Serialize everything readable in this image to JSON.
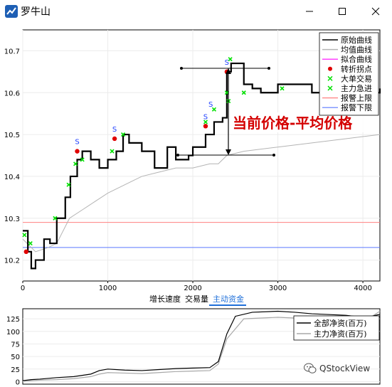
{
  "window": {
    "title": "罗牛山"
  },
  "main_chart": {
    "y_ticks": [
      "10.7",
      "10.6",
      "10.5",
      "10.4",
      "10.3",
      "10.2"
    ],
    "x_ticks": [
      "0",
      "1000",
      "2000",
      "3000",
      "4000"
    ],
    "legend": [
      "原始曲线",
      "均值曲线",
      "拟合曲线",
      "转折拐点",
      "大单交易",
      "主力急进",
      "报警上限",
      "报警下限"
    ],
    "annotation": "当前价格-平均价格",
    "s_markers": [
      "S",
      "S",
      "S",
      "S",
      "S",
      "S"
    ],
    "colors": {
      "price": "#000000",
      "mean": "#b4b4b4",
      "fit": "#ff00ff",
      "turn": "#e00000",
      "bigtrade": "#00e000",
      "upper": "#ff8080",
      "lower": "#5a78ff",
      "annotation": "#d40000"
    },
    "chart_data": {
      "type": "line",
      "x_range": [
        0,
        4200
      ],
      "ylim": [
        10.15,
        10.75
      ],
      "alarm_upper": 10.29,
      "alarm_lower": 10.23,
      "series": [
        {
          "name": "原始曲线",
          "x": [
            0,
            60,
            100,
            150,
            250,
            320,
            400,
            500,
            560,
            640,
            700,
            800,
            900,
            1000,
            1100,
            1180,
            1250,
            1400,
            1550,
            1700,
            1800,
            1950,
            2000,
            2150,
            2250,
            2350,
            2400,
            2450,
            2600,
            2700,
            2800,
            3000,
            3200,
            3400,
            3600,
            3800,
            4000,
            4150,
            4200
          ],
          "y": [
            10.27,
            10.22,
            10.18,
            10.2,
            10.25,
            10.24,
            10.3,
            10.35,
            10.4,
            10.44,
            10.46,
            10.44,
            10.42,
            10.44,
            10.46,
            10.5,
            10.48,
            10.46,
            10.42,
            10.47,
            10.44,
            10.45,
            10.47,
            10.5,
            10.53,
            10.54,
            10.65,
            10.67,
            10.62,
            10.61,
            10.6,
            10.62,
            10.62,
            10.6,
            10.6,
            10.58,
            10.56,
            10.6,
            10.61
          ]
        },
        {
          "name": "均值曲线",
          "x": [
            0,
            150,
            300,
            400,
            550,
            700,
            850,
            1000,
            1200,
            1400,
            1600,
            1800,
            2000,
            2200,
            2300,
            2400,
            2600,
            3000,
            3400,
            3800,
            4200
          ],
          "y": [
            10.25,
            10.22,
            10.23,
            10.24,
            10.3,
            10.32,
            10.34,
            10.36,
            10.38,
            10.4,
            10.41,
            10.42,
            10.42,
            10.43,
            10.43,
            10.45,
            10.46,
            10.47,
            10.48,
            10.49,
            10.5
          ]
        }
      ],
      "turn_points": [
        {
          "x": 40,
          "y": 10.22
        },
        {
          "x": 640,
          "y": 10.46
        },
        {
          "x": 1080,
          "y": 10.49
        },
        {
          "x": 2150,
          "y": 10.52
        },
        {
          "x": 2400,
          "y": 10.65
        }
      ],
      "big_trades": [
        {
          "x": 20,
          "y": 10.26
        },
        {
          "x": 90,
          "y": 10.24
        },
        {
          "x": 380,
          "y": 10.3
        },
        {
          "x": 540,
          "y": 10.38
        },
        {
          "x": 620,
          "y": 10.43
        },
        {
          "x": 700,
          "y": 10.44
        },
        {
          "x": 1050,
          "y": 10.46
        },
        {
          "x": 1180,
          "y": 10.5
        },
        {
          "x": 2150,
          "y": 10.53
        },
        {
          "x": 2250,
          "y": 10.56
        },
        {
          "x": 2400,
          "y": 10.6
        },
        {
          "x": 2420,
          "y": 10.58
        },
        {
          "x": 2440,
          "y": 10.68
        },
        {
          "x": 2600,
          "y": 10.6
        },
        {
          "x": 3050,
          "y": 10.61
        },
        {
          "x": 3950,
          "y": 10.6
        },
        {
          "x": 4150,
          "y": 10.62
        }
      ]
    }
  },
  "tabs": [
    "增长速度",
    "交易量",
    "主动资金"
  ],
  "active_tab": 2,
  "sub_chart": {
    "y_ticks": [
      "125",
      "100",
      "75",
      "50",
      "25",
      "0"
    ],
    "legend": [
      "全部净资(百万)",
      "主力净资(百万)"
    ],
    "chart_data": {
      "type": "line",
      "x_range": [
        0,
        4200
      ],
      "ylim": [
        -5,
        145
      ],
      "series": [
        {
          "name": "全部净资(百万)",
          "x": [
            0,
            100,
            200,
            400,
            600,
            800,
            900,
            1000,
            1200,
            1400,
            1600,
            1800,
            2000,
            2200,
            2300,
            2400,
            2500,
            2700,
            3000,
            3200,
            3400,
            3800,
            4000,
            4100,
            4200
          ],
          "y": [
            2,
            4,
            5,
            8,
            10,
            15,
            22,
            25,
            23,
            22,
            24,
            26,
            27,
            28,
            40,
            95,
            130,
            138,
            140,
            138,
            135,
            132,
            128,
            130,
            134
          ]
        },
        {
          "name": "主力净资(百万)",
          "x": [
            0,
            200,
            400,
            600,
            800,
            900,
            1000,
            1200,
            1400,
            1600,
            1800,
            2000,
            2200,
            2300,
            2400,
            2600,
            3000,
            3400,
            3800,
            4000,
            4200
          ],
          "y": [
            1,
            3,
            4,
            6,
            10,
            15,
            18,
            17,
            16,
            18,
            20,
            21,
            22,
            35,
            85,
            125,
            128,
            125,
            122,
            118,
            140
          ]
        }
      ]
    }
  },
  "watermark": {
    "text": "QStockView",
    "icon": "wechat-icon"
  }
}
